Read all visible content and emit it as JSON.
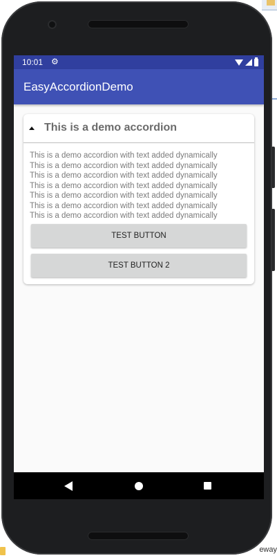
{
  "desktop": {
    "bottom_right_text": "eway"
  },
  "statusbar": {
    "time": "10:01",
    "settings_icon": "gear-icon",
    "wifi_icon": "wifi-icon",
    "signal_icon": "signal-icon",
    "battery_icon": "battery-icon"
  },
  "appbar": {
    "title": "EasyAccordionDemo"
  },
  "accordion": {
    "title": "This is a demo accordion",
    "expanded_icon": "caret-up-icon",
    "lines": [
      "This is a demo accordion with text added dynamically",
      "This is a demo accordion with text added dynamically",
      "This is a demo accordion with text added dynamically",
      "This is a demo accordion with text added dynamically",
      "This is a demo accordion with text added dynamically",
      "This is a demo accordion with text added dynamically",
      "This is a demo accordion with text added dynamically"
    ],
    "button1_label": "TEST BUTTON",
    "button2_label": "TEST BUTTON 2"
  },
  "navbar": {
    "back_icon": "back-icon",
    "home_icon": "home-icon",
    "recents_icon": "recents-icon"
  },
  "colors": {
    "statusbar": "#303f9f",
    "appbar": "#3f51b5",
    "button": "#d6d7d7",
    "background": "#fafafa"
  }
}
